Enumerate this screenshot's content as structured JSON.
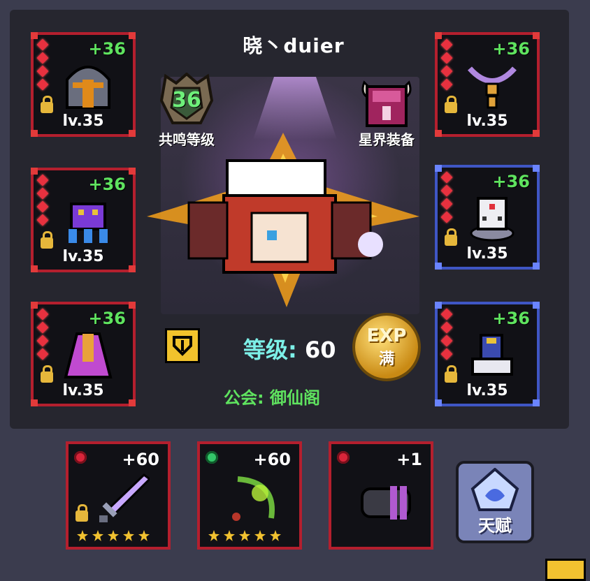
{
  "player": {
    "name": "晓丶duier",
    "level_label": "等级: ",
    "level_value": "60",
    "guild_label": "公会: ",
    "guild_name": "御仙阁"
  },
  "emblems": {
    "resonance_value": "36",
    "resonance_label": "共鸣等级",
    "astral_label": "星界装备"
  },
  "exp_badge": {
    "exp_text": "EXP",
    "full_text": "满"
  },
  "equipment_left": [
    {
      "item": "helmet",
      "plus": "+36",
      "level": "lv.35",
      "locked": true,
      "frame": "red"
    },
    {
      "item": "purple-creature",
      "plus": "+36",
      "level": "lv.35",
      "locked": true,
      "frame": "red"
    },
    {
      "item": "purple-cape",
      "plus": "+36",
      "level": "lv.35",
      "locked": true,
      "frame": "red"
    }
  ],
  "equipment_right": [
    {
      "item": "necklace",
      "plus": "+36",
      "level": "lv.35",
      "locked": true,
      "frame": "red"
    },
    {
      "item": "dice-ring",
      "plus": "+36",
      "level": "lv.35",
      "locked": true,
      "frame": "blue"
    },
    {
      "item": "boots",
      "plus": "+36",
      "level": "lv.35",
      "locked": true,
      "frame": "blue"
    }
  ],
  "weapons": [
    {
      "item": "rainbow-sword",
      "plus": "+60",
      "gem": "red",
      "stars": 5,
      "locked": true
    },
    {
      "item": "green-bow",
      "plus": "+60",
      "gem": "green",
      "stars": 5,
      "locked": false
    },
    {
      "item": "gatling-barrel",
      "plus": "+1",
      "gem": "red",
      "stars": 0,
      "locked": false
    }
  ],
  "talent": {
    "label": "天赋"
  },
  "colors": {
    "plus_green": "#5fe35f",
    "frame_red": "#b41f2e",
    "frame_blue": "#3f56c4",
    "level_cyan": "#7df0e8"
  }
}
